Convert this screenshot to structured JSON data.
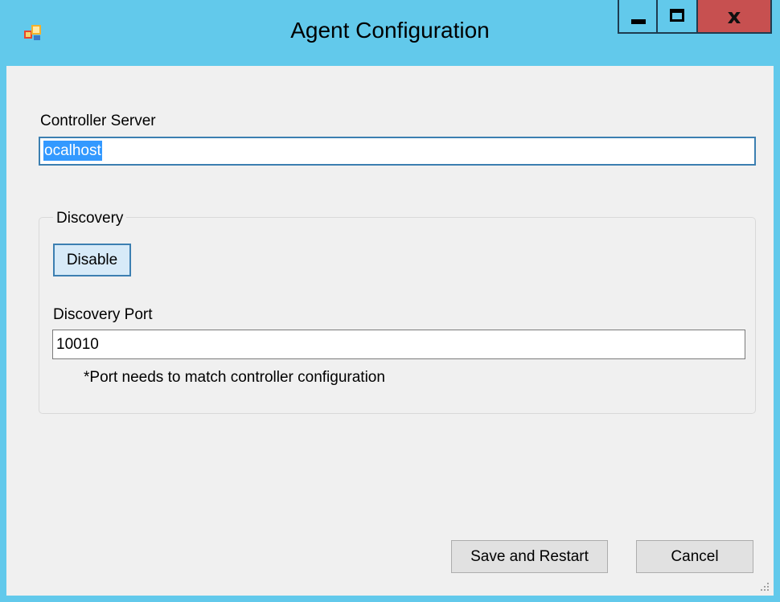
{
  "window": {
    "title": "Agent Configuration",
    "app_icon": "windows-form-icon",
    "controls": {
      "minimize": "minimize-icon",
      "maximize": "maximize-icon",
      "close_label": "x"
    }
  },
  "controller": {
    "label": "Controller Server",
    "value": "ocalhost"
  },
  "discovery": {
    "group_title": "Discovery",
    "toggle_label": "Disable",
    "port_label": "Discovery Port",
    "port_value": "10010",
    "port_note": "*Port needs to match controller configuration"
  },
  "actions": {
    "save_label": "Save and Restart",
    "cancel_label": "Cancel"
  },
  "colors": {
    "titlebar": "#62c9eb",
    "close_button": "#c75050",
    "client_background": "#f0f0f0",
    "focus_border": "#3c7fb1",
    "selection": "#3399ff"
  }
}
